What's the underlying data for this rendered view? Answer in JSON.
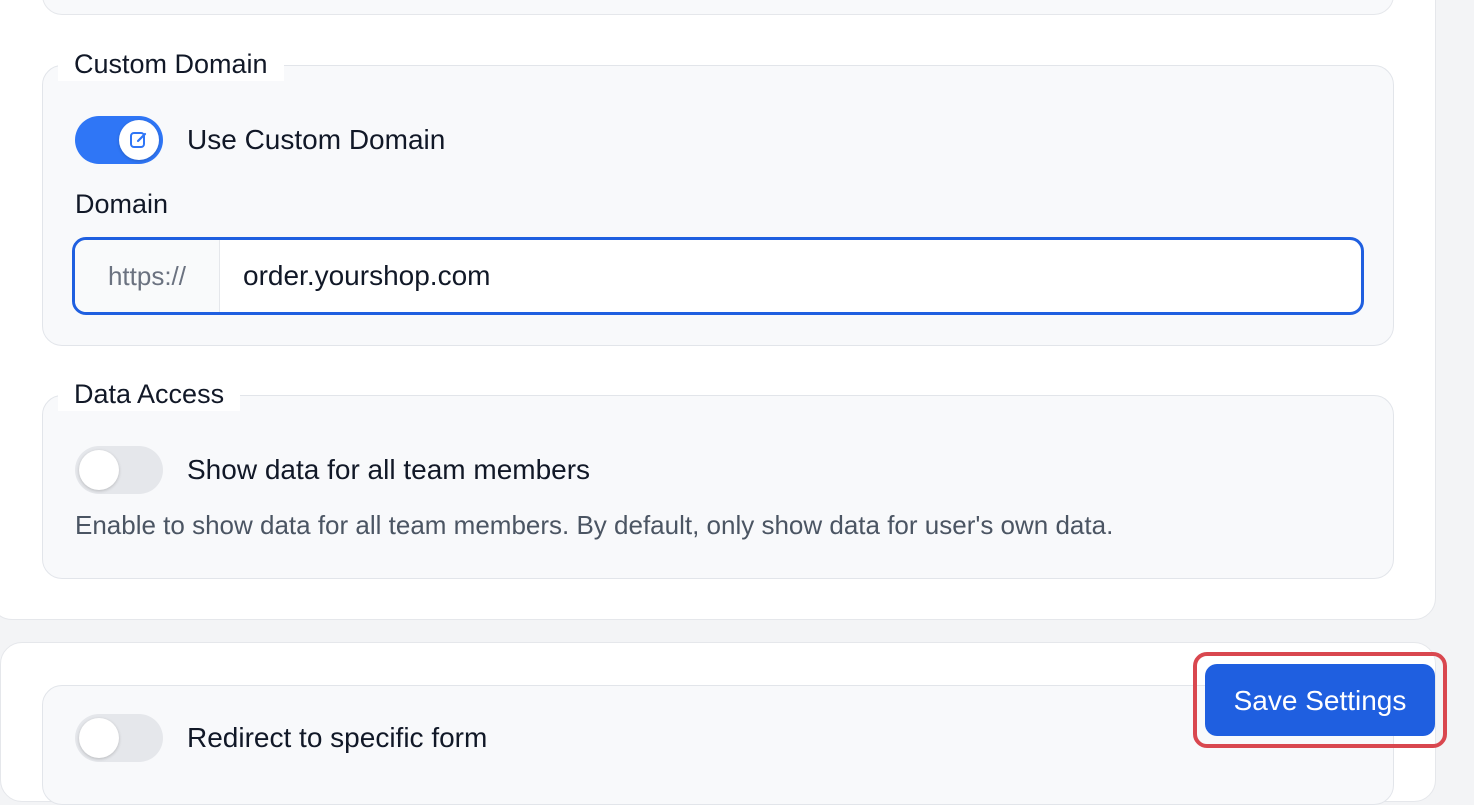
{
  "custom_domain_section": {
    "legend": "Custom Domain",
    "toggle_label": "Use Custom Domain",
    "toggle_state": "on",
    "domain_label": "Domain",
    "domain_prefix": "https://",
    "domain_value": "order.yourshop.com"
  },
  "data_access_section": {
    "legend": "Data Access",
    "toggle_label": "Show data for all team members",
    "toggle_state": "off",
    "help_text": "Enable to show data for all team members. By default, only show data for user's own data."
  },
  "redirect_section": {
    "toggle_label": "Redirect to specific form",
    "toggle_state": "off"
  },
  "save_button": {
    "label": "Save Settings"
  },
  "colors": {
    "accent": "#1f5fe0",
    "toggle_on": "#2f76f6",
    "highlight": "#d9474f"
  }
}
